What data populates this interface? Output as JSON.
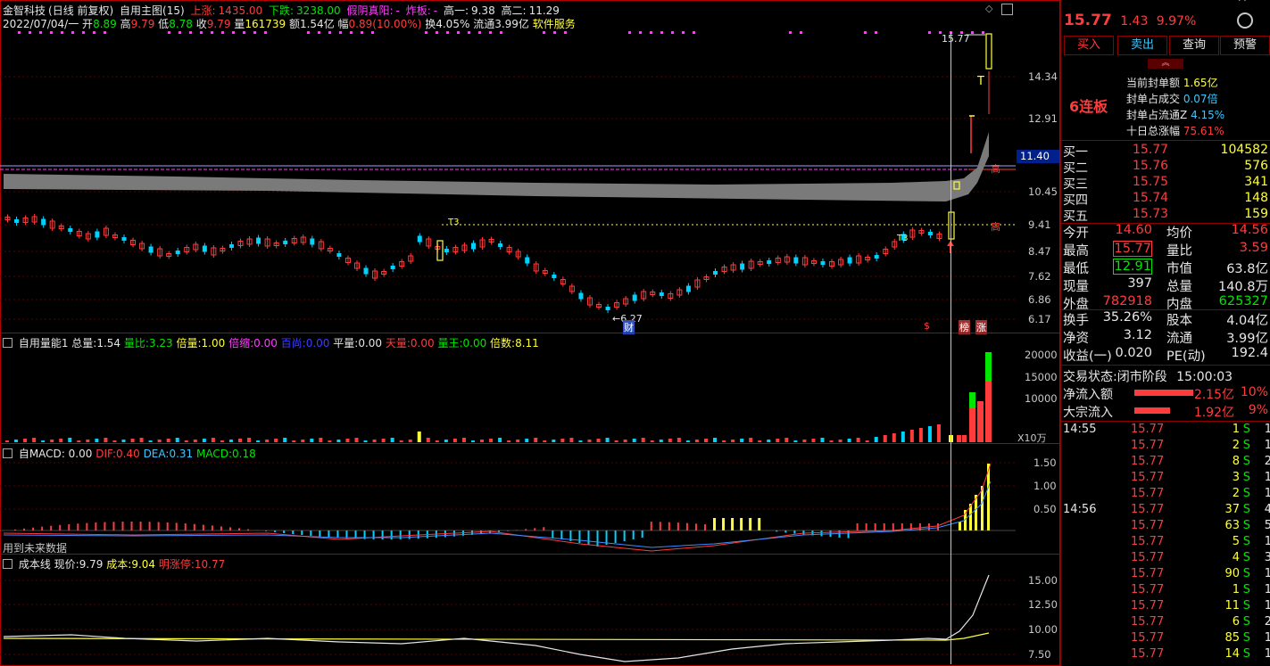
{
  "header": {
    "name": "金智科技",
    "mode": "(日线 前复权)",
    "main_indicator": "自用主图(15)",
    "up_label": "上涨:",
    "up_value": "1435.00",
    "down_label": "下跌:",
    "down_value": "3238.00",
    "fake_label": "假阴真阳:",
    "fake_value": "-",
    "blast_label": "炸板:",
    "blast_value": "-",
    "high1_label": "高一:",
    "high1_value": "9.38",
    "high2_label": "高二:",
    "high2_value": "11.29"
  },
  "quote_bar": {
    "date": "2022/07/04/一",
    "open_label": "开",
    "open": "8.89",
    "high_label": "高",
    "high": "9.79",
    "low_label": "低",
    "low": "8.78",
    "close_label": "收",
    "close": "9.79",
    "volume_label": "量",
    "volume": "161739",
    "amount_label": "额",
    "amount": "1.54亿",
    "change_label": "幅",
    "change": "0.89(10.00%)",
    "turnover_label": "换",
    "turnover": "4.05%",
    "float_label": "流通",
    "float": "3.99亿",
    "service": "软件服务"
  },
  "main_chart": {
    "price_axis": [
      "14.34",
      "12.91",
      "10.45",
      "9.41",
      "8.47",
      "7.62",
      "6.86",
      "6.17"
    ],
    "highlight_price": "11.40",
    "high_marker": "高",
    "high_price_tag": "15.77",
    "low_tag": "←6.27",
    "t3_label": "T3",
    "t_label": "T",
    "cai_badge": "财",
    "dollar_badge": "$",
    "bang_badge": "榜",
    "zhang_badge": "涨"
  },
  "volume_panel": {
    "title": "自用量能1",
    "total_label": "总量:",
    "total": "1.54",
    "ratio_label": "量比:",
    "ratio": "3.23",
    "multi_label": "倍量:",
    "multi": "1.00",
    "shrink_label": "倍缩:",
    "shrink": "0.00",
    "hundred_label": "百尚:",
    "hundred": "0.00",
    "flat_label": "平量:",
    "flat": "0.00",
    "sky_label": "天量:",
    "sky": "0.00",
    "king_label": "量王:",
    "king": "0.00",
    "times_label": "倍数:",
    "times": "8.11",
    "axis": [
      "20000",
      "15000",
      "10000"
    ],
    "unit": "X10万"
  },
  "macd_panel": {
    "title": "自MACD",
    "title_value": ": 0.00",
    "dif_label": "DIF:",
    "dif": "0.40",
    "dea_label": "DEA:",
    "dea": "0.31",
    "macd_label": "MACD:",
    "macd": "0.18",
    "axis": [
      "1.50",
      "1.00",
      "0.50"
    ],
    "note": "用到未来数据"
  },
  "cost_panel": {
    "title": "成本线",
    "price_label": "现价:",
    "price": "9.79",
    "cost_label": "成本:",
    "cost": "9.04",
    "limit_label": "明涨停:",
    "limit": "10.77",
    "axis": [
      "15.00",
      "12.50",
      "10.00",
      "7.50"
    ]
  },
  "right_panel": {
    "price": "15.77",
    "change": "1.43",
    "change_pct": "9.97%",
    "buttons": [
      "买入",
      "卖出",
      "查询",
      "预警"
    ],
    "seal_amount_label": "当前封单额",
    "seal_amount": "1.65亿",
    "seal_ratio_label": "封单占成交",
    "seal_ratio": "0.07倍",
    "seal_float_label": "封单占流通Z",
    "seal_float": "4.15%",
    "ten_day_label": "十日总涨幅",
    "ten_day": "75.61%",
    "board": "6连板",
    "bids": [
      {
        "label": "买一",
        "price": "15.77",
        "vol": "104582"
      },
      {
        "label": "买二",
        "price": "15.76",
        "vol": "576"
      },
      {
        "label": "买三",
        "price": "15.75",
        "vol": "341"
      },
      {
        "label": "买四",
        "price": "15.74",
        "vol": "148"
      },
      {
        "label": "买五",
        "price": "15.73",
        "vol": "159"
      }
    ],
    "stats": [
      {
        "l1": "今开",
        "v1": "14.60",
        "l2": "均价",
        "v2": "14.56"
      },
      {
        "l1": "最高",
        "v1": "15.77",
        "l2": "量比",
        "v2": "3.59"
      },
      {
        "l1": "最低",
        "v1": "12.91",
        "l2": "市值",
        "v2": "63.8亿"
      },
      {
        "l1": "现量",
        "v1": "397",
        "l2": "总量",
        "v2": "140.8万"
      },
      {
        "l1": "外盘",
        "v1": "782918",
        "l2": "内盘",
        "v2": "625327"
      }
    ],
    "stats2": [
      {
        "l1": "换手",
        "v1": "35.26%",
        "l2": "股本",
        "v2": "4.04亿"
      },
      {
        "l1": "净资",
        "v1": "3.12",
        "l2": "流通",
        "v2": "3.99亿"
      },
      {
        "l1": "收益(一)",
        "v1": "0.020",
        "l2": "PE(动)",
        "v2": "192.4"
      }
    ],
    "status_label": "交易状态:",
    "status": "闭市阶段",
    "status_time": "15:00:03",
    "net_inflow_label": "净流入额",
    "net_inflow": "2.15亿",
    "net_inflow_pct": "10%",
    "block_inflow_label": "大宗流入",
    "block_inflow": "1.92亿",
    "block_inflow_pct": "9%",
    "ticks": [
      {
        "time": "14:55",
        "price": "15.77",
        "vol": "1",
        "side": "S",
        "n": "1"
      },
      {
        "time": "",
        "price": "15.77",
        "vol": "2",
        "side": "S",
        "n": "1"
      },
      {
        "time": "",
        "price": "15.77",
        "vol": "8",
        "side": "S",
        "n": "2"
      },
      {
        "time": "",
        "price": "15.77",
        "vol": "3",
        "side": "S",
        "n": "1"
      },
      {
        "time": "",
        "price": "15.77",
        "vol": "2",
        "side": "S",
        "n": "1"
      },
      {
        "time": "14:56",
        "price": "15.77",
        "vol": "37",
        "side": "S",
        "n": "4"
      },
      {
        "time": "",
        "price": "15.77",
        "vol": "63",
        "side": "S",
        "n": "5"
      },
      {
        "time": "",
        "price": "15.77",
        "vol": "5",
        "side": "S",
        "n": "1"
      },
      {
        "time": "",
        "price": "15.77",
        "vol": "4",
        "side": "S",
        "n": "3"
      },
      {
        "time": "",
        "price": "15.77",
        "vol": "90",
        "side": "S",
        "n": "1"
      },
      {
        "time": "",
        "price": "15.77",
        "vol": "1",
        "side": "S",
        "n": "1"
      },
      {
        "time": "",
        "price": "15.77",
        "vol": "11",
        "side": "S",
        "n": "1"
      },
      {
        "time": "",
        "price": "15.77",
        "vol": "6",
        "side": "S",
        "n": "2"
      },
      {
        "time": "",
        "price": "15.77",
        "vol": "85",
        "side": "S",
        "n": "1"
      },
      {
        "time": "",
        "price": "15.77",
        "vol": "14",
        "side": "S",
        "n": "1"
      }
    ]
  },
  "colors": {
    "up": "#ff3c3c",
    "down": "#00d2ff",
    "border": "#b40000",
    "yellow": "#ffff3c",
    "magenta": "#ff3cff",
    "green": "#00e600",
    "band": "#7a7a7a"
  }
}
